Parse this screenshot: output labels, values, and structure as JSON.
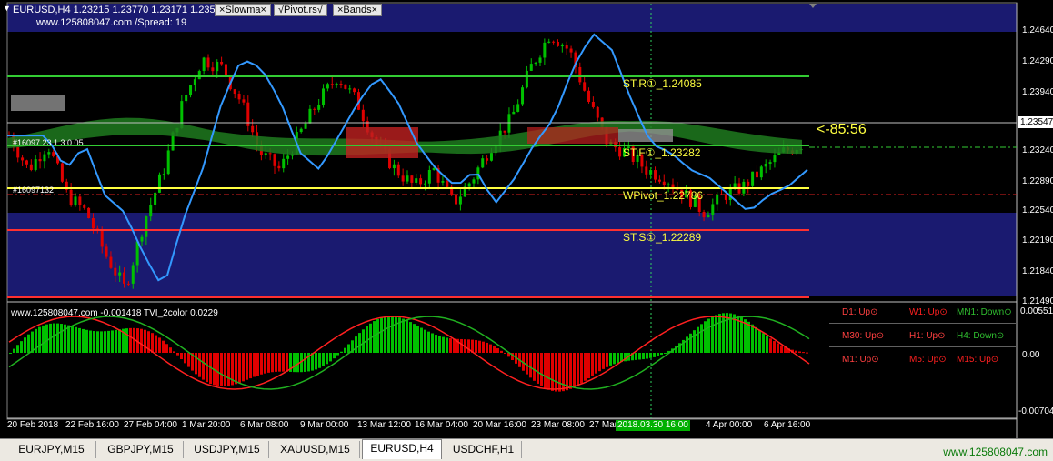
{
  "header": {
    "symbol_line": "EURUSD,H4  1.23215 1.23770 1.23171 1.23547",
    "spread_line": "www.125808047.com /Spread:    19",
    "buttons": [
      "×Slowma×",
      "√Pivot.rs√",
      "×Bands×"
    ]
  },
  "price_axis": [
    "1.24640",
    "1.24290",
    "1.23940",
    "1.23547",
    "1.23240",
    "1.22890",
    "1.22540",
    "1.22190",
    "1.21840",
    "1.21490"
  ],
  "current_price": "1.23547",
  "countdown": "<-85:56",
  "levels": {
    "str": "ST.R①_1.24085",
    "stf": "ST.F①_1.23282",
    "wpivot": "WPivot_1.22786",
    "sts": "ST.S①_1.22289",
    "left_label_1": "#16097.23 1.3.0.05",
    "left_label_2": "#16097132"
  },
  "indicator": {
    "title": "www.125808047.com -0.001418  TVI_2color 0.0229",
    "axis": [
      "0.005517",
      "0.00",
      "-0.00704"
    ]
  },
  "trend_panel": [
    {
      "label": "D1: Up⊙",
      "color": "#ff4040"
    },
    {
      "label": "W1: Up⊙",
      "color": "#ff2020"
    },
    {
      "label": "MN1: Down⊙",
      "color": "#30c030"
    },
    {
      "label": "M30: Up⊙",
      "color": "#ff4040"
    },
    {
      "label": "H1: Up⊙",
      "color": "#ff4040"
    },
    {
      "label": "H4: Down⊙",
      "color": "#30c030"
    },
    {
      "label": "M1: Up⊙",
      "color": "#ff4040"
    },
    {
      "label": "M5: Up⊙",
      "color": "#ff2020"
    },
    {
      "label": "M15: Up⊙",
      "color": "#ff2020"
    }
  ],
  "time_axis": [
    "20 Feb 2018",
    "22 Feb 16:00",
    "27 Feb 04:00",
    "1 Mar 20:00",
    "6 Mar 08:00",
    "9 Mar 00:00",
    "13 Mar 12:00",
    "16 Mar 04:00",
    "20 Mar 16:00",
    "23 Mar 08:00",
    "27 Mar",
    "4 Apr 00:00",
    "6 Apr 16:00"
  ],
  "cursor_time": "2018.03.30 16:00",
  "tabs": [
    "EURJPY,M15",
    "GBPJPY,M15",
    "USDJPY,M15",
    "XAUUSD,M15",
    "EURUSD,H4",
    "USDCHF,H1"
  ],
  "active_tab": "EURUSD,H4",
  "site_link": "www.125808047.com",
  "colors": {
    "bull": "#00c000",
    "bear": "#e00000",
    "band": "#1a1a70",
    "resistance": "#33cc33",
    "support": "#ff3030",
    "pivot": "#ffff40",
    "ma_blue": "#3399ff"
  }
}
